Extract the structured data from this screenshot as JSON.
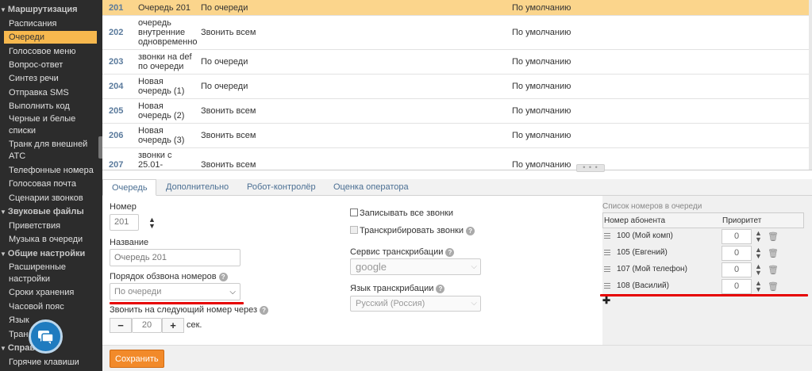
{
  "sidebar": {
    "sections": [
      {
        "label": "Маршрутизация"
      },
      {
        "label": "Звуковые файлы"
      },
      {
        "label": "Общие настройки"
      },
      {
        "label": "Справка"
      }
    ],
    "routing_items": [
      "Расписания",
      "Очереди",
      "Голосовое меню",
      "Вопрос-ответ",
      "Синтез речи",
      "Отправка SMS",
      "Выполнить код",
      "Черные и белые списки",
      "Транк для внешней АТС",
      "Телефонные номера",
      "Голосовая почта",
      "Сценарии звонков"
    ],
    "sound_items": [
      "Приветствия",
      "Музыка в очереди"
    ],
    "general_items": [
      "Расширенные настройки",
      "Сроки хранения",
      "Часовой пояс",
      "Язык",
      "Транслитерация"
    ],
    "help_items": [
      "Горячие клавиши"
    ],
    "active_item": "Очереди",
    "collapsed_section_label": "Справ",
    "obscured_item_label": "Тран"
  },
  "queues": [
    {
      "number": "201",
      "name": "Очередь 201",
      "mode": "По очереди",
      "strategy": "По умолчанию"
    },
    {
      "number": "202",
      "name": "очередь\nвнутренние\nодновременно",
      "mode": "Звонить всем",
      "strategy": "По умолчанию"
    },
    {
      "number": "203",
      "name": "звонки на def\nпо очереди",
      "mode": "По очереди",
      "strategy": "По умолчанию"
    },
    {
      "number": "204",
      "name": "Новая\nочередь (1)",
      "mode": "По очереди",
      "strategy": "По умолчанию"
    },
    {
      "number": "205",
      "name": "Новая\nочередь (2)",
      "mode": "Звонить всем",
      "strategy": "По умолчанию"
    },
    {
      "number": "206",
      "name": "Новая\nочередь (3)",
      "mode": "Звонить всем",
      "strategy": "По умолчанию"
    },
    {
      "number": "207",
      "name": "звонки с\n25.01-",
      "mode": "Звонить всем",
      "strategy": "По умолчанию"
    }
  ],
  "splitter": {
    "label": "• • •"
  },
  "tabs": [
    "Очередь",
    "Дополнительно",
    "Робот-контролёр",
    "Оценка оператора"
  ],
  "form": {
    "number_label": "Номер",
    "number_value": "201",
    "name_label": "Название",
    "name_value": "Очередь 201",
    "order_label": "Порядок обзвона номеров",
    "order_value": "По очереди",
    "next_label": "Звонить на следующий номер через",
    "next_value": "20",
    "seconds_label": "сек.",
    "record_label": "Записывать все звонки",
    "transcribe_label": "Транскрибировать звонки",
    "service_label": "Сервис транскрибации",
    "service_value": "google",
    "language_label": "Язык транскрибации",
    "language_value": "Русский (Россия)",
    "help_icon": "?",
    "minus": "−",
    "plus": "+"
  },
  "members": {
    "title": "Список номеров в очереди",
    "col_number": "Номер абонента",
    "col_priority": "Приоритет",
    "rows": [
      {
        "name": "100 (Мой комп)",
        "priority": "0"
      },
      {
        "name": "105 (Евгений)",
        "priority": "0"
      },
      {
        "name": "107 (Мой телефон)",
        "priority": "0"
      },
      {
        "name": "108 (Василий)",
        "priority": "0"
      }
    ],
    "add_symbol": "✚"
  },
  "footer": {
    "save_label": "Сохранить"
  },
  "colors": {
    "accent": "#f7b84e",
    "selected_row": "#fbd58c",
    "save_button": "#f28a2a",
    "annotation_red": "#e60000",
    "sidebar_bg": "#2c2c2c",
    "chat_fab": "#1f7bbf"
  }
}
